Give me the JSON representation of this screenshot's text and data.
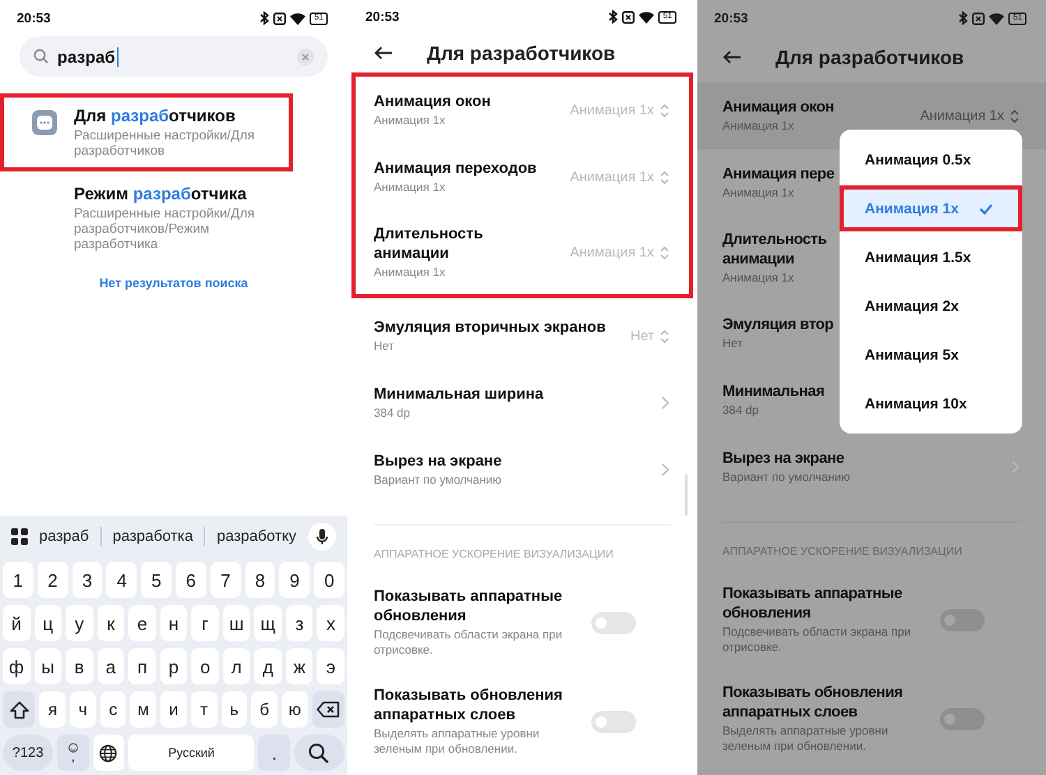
{
  "search_screen": {
    "status_bar": {
      "time": "20:53",
      "battery": "51"
    },
    "search": {
      "value": "разраб"
    },
    "results": [
      {
        "title_parts": [
          {
            "text": "Для ",
            "match": false
          },
          {
            "text": "разраб",
            "match": true
          },
          {
            "text": "отчиков",
            "match": false
          }
        ],
        "path": "Расширенные настройки/Для разработчиков",
        "has_icon": true,
        "highlighted": true
      },
      {
        "title_parts": [
          {
            "text": "Режим ",
            "match": false
          },
          {
            "text": "разраб",
            "match": true
          },
          {
            "text": "отчика",
            "match": false
          }
        ],
        "path": "Расширенные настройки/Для разработчиков/Режим разработчика",
        "has_icon": false,
        "highlighted": false
      }
    ],
    "no_results": "Нет результатов поиска",
    "keyboard": {
      "suggestions": [
        "разраб",
        "разработка",
        "разработку"
      ],
      "rows": [
        {
          "kind": "plain",
          "keys": [
            "1",
            "2",
            "3",
            "4",
            "5",
            "6",
            "7",
            "8",
            "9",
            "0"
          ]
        },
        {
          "kind": "plain",
          "keys": [
            "й",
            "ц",
            "у",
            "к",
            "е",
            "н",
            "г",
            "ш",
            "щ",
            "з",
            "х"
          ]
        },
        {
          "kind": "plain",
          "keys": [
            "ф",
            "ы",
            "в",
            "а",
            "п",
            "р",
            "о",
            "л",
            "д",
            "ж",
            "э"
          ]
        },
        {
          "kind": "shift",
          "keys": [
            "я",
            "ч",
            "с",
            "м",
            "и",
            "т",
            "ь",
            "б",
            "ю"
          ]
        }
      ],
      "symbols": "?123",
      "comma": ",",
      "space": "Русский",
      "period": "."
    }
  },
  "settings_screen": {
    "status_bar": {
      "time": "20:53",
      "battery": "51"
    },
    "title": "Для разработчиков",
    "sections": [
      {
        "highlighted": true,
        "rows": [
          {
            "kind": "select",
            "title": "Анимация окон",
            "subtitle": "Анимация 1x",
            "value": "Анимация 1x"
          },
          {
            "kind": "select",
            "title": "Анимация переходов",
            "subtitle": "Анимация 1x",
            "value": "Анимация 1x"
          },
          {
            "kind": "select",
            "title": "Длительность анимации",
            "subtitle": "Анимация 1x",
            "value": "Анимация 1x"
          }
        ]
      },
      {
        "highlighted": false,
        "rows": [
          {
            "kind": "select",
            "title": "Эмуляция вторичных экранов",
            "subtitle": "Нет",
            "value": "Нет"
          },
          {
            "kind": "link",
            "title": "Минимальная ширина",
            "subtitle": "384 dp"
          },
          {
            "kind": "link",
            "title": "Вырез на экране",
            "subtitle": "Вариант по умолчанию"
          }
        ]
      },
      {
        "highlighted": false,
        "header": "АППАРАТНОЕ УСКОРЕНИЕ ВИЗУАЛИЗАЦИИ",
        "rows": [
          {
            "kind": "toggle",
            "title": "Показывать аппаратные обновления",
            "subtitle": "Подсвечивать области экрана при отрисовке.",
            "on": false
          },
          {
            "kind": "toggle",
            "title": "Показывать обновления аппаратных слоев",
            "subtitle": "Выделять аппаратные уровни зеленым при обновлении.",
            "on": false
          }
        ]
      }
    ]
  },
  "picker_screen": {
    "status_bar": {
      "time": "20:53",
      "battery": "51"
    },
    "title": "Для разработчиков",
    "sections": [
      {
        "highlighted": false,
        "rows": [
          {
            "kind": "select",
            "title": "Анимация окон",
            "subtitle": "Анимация 1x",
            "value": "Анимация 1x",
            "pressed": true
          },
          {
            "kind": "covered",
            "title": "Анимация пере",
            "subtitle": "Анимация 1x",
            "pressed": false
          },
          {
            "kind": "covered",
            "title": "Длительность анимации",
            "subtitle": "Анимация 1x",
            "pressed": false
          },
          {
            "kind": "covered",
            "title": "Эмуляция втор",
            "subtitle": "Нет",
            "pressed": false
          },
          {
            "kind": "covered",
            "title": "Минимальная",
            "subtitle": "384 dp",
            "pressed": false
          },
          {
            "kind": "link",
            "title": "Вырез на экране",
            "subtitle": "Вариант по умолчанию",
            "pressed": false
          }
        ]
      },
      {
        "highlighted": false,
        "header": "АППАРАТНОЕ УСКОРЕНИЕ ВИЗУАЛИЗАЦИИ",
        "rows": [
          {
            "kind": "toggle",
            "title": "Показывать аппаратные обновления",
            "subtitle": "Подсвечивать области экрана при отрисовке.",
            "on": false,
            "pressed": false
          },
          {
            "kind": "toggle",
            "title": "Показывать обновления аппаратных слоев",
            "subtitle": "Выделять аппаратные уровни зеленым при обновлении.",
            "on": false,
            "pressed": false
          }
        ]
      }
    ],
    "menu": {
      "options": [
        {
          "label": "Анимация 0.5x",
          "selected": false,
          "highlighted": false
        },
        {
          "label": "Анимация 1x",
          "selected": true,
          "highlighted": true
        },
        {
          "label": "Анимация 1.5x",
          "selected": false,
          "highlighted": false
        },
        {
          "label": "Анимация 2x",
          "selected": false,
          "highlighted": false
        },
        {
          "label": "Анимация 5x",
          "selected": false,
          "highlighted": false
        },
        {
          "label": "Анимация 10x",
          "selected": false,
          "highlighted": false
        }
      ]
    }
  }
}
